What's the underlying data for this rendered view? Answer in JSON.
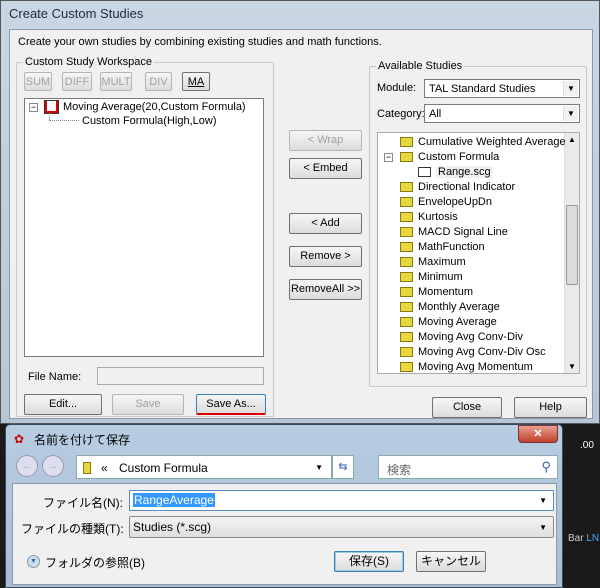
{
  "dialog": {
    "title": "Create Custom Studies",
    "intro": "Create your own studies by combining existing studies and math functions.",
    "workspace": {
      "label": "Custom Study Workspace",
      "buttons": [
        "SUM",
        "DIFF",
        "MULT",
        "DIV",
        "MA"
      ],
      "tree": [
        "Moving Average(20,Custom Formula)",
        "Custom Formula(High,Low)"
      ],
      "file_name_label": "File Name:",
      "file_name_value": "",
      "edit": "Edit...",
      "save": "Save",
      "save_as": "Save As..."
    },
    "middle": {
      "wrap": "< Wrap",
      "embed": "< Embed",
      "add": "< Add",
      "remove": "Remove >",
      "remove_all": "RemoveAll >>"
    },
    "available": {
      "label": "Available Studies",
      "module_label": "Module:",
      "module_value": "TAL Standard Studies",
      "category_label": "Category:",
      "category_value": "All",
      "items": [
        "Cumulative Weighted Average",
        "Custom Formula",
        "Range.scg",
        "Directional Indicator",
        "EnvelopeUpDn",
        "Kurtosis",
        "MACD Signal Line",
        "MathFunction",
        "Maximum",
        "Minimum",
        "Momentum",
        "Monthly Average",
        "Moving Average",
        "Moving Avg Conv-Div",
        "Moving Avg Conv-Div Osc",
        "Moving Avg Momentum"
      ]
    },
    "close": "Close",
    "help": "Help"
  },
  "save_dialog": {
    "title": "名前を付けて保存",
    "path": "Custom Formula",
    "path_prefix": "«",
    "search_placeholder": "検索",
    "file_name_label": "ファイル名(N):",
    "file_name_value": "RangeAverage",
    "type_label": "ファイルの種類(T):",
    "type_value": "Studies (*.scg)",
    "browse": "フォルダの参照(B)",
    "save": "保存(S)",
    "cancel": "キャンセル"
  },
  "background": {
    "text1": ".00",
    "text2": "Bar",
    "text3": "LN"
  }
}
